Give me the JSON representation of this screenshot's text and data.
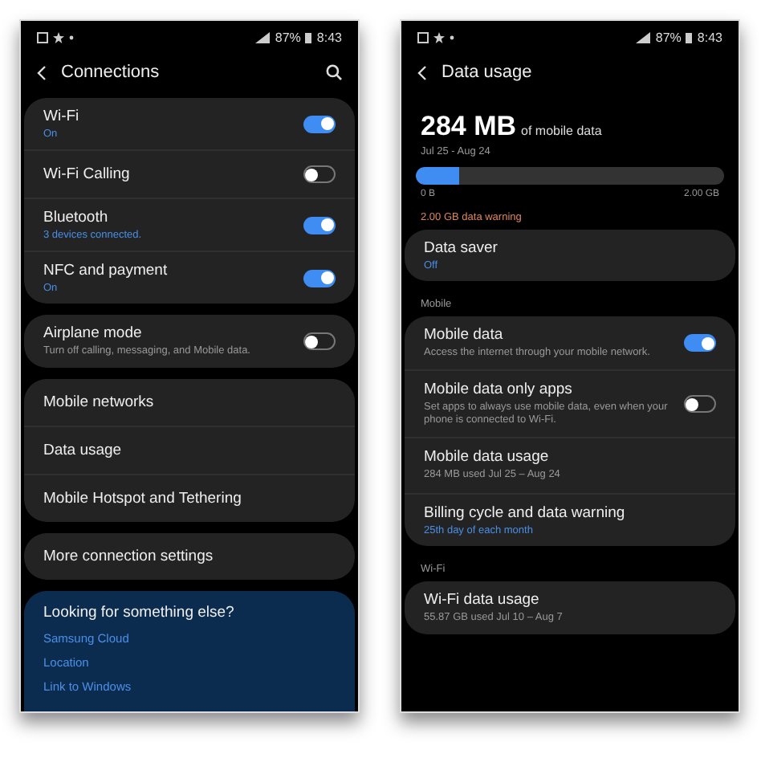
{
  "connections": {
    "status_bar": {
      "battery": "87%",
      "time": "8:43"
    },
    "title": "Connections",
    "groups": [
      {
        "items": [
          {
            "label": "Wi-Fi",
            "status": "On",
            "toggle": true
          },
          {
            "label": "Wi-Fi Calling",
            "toggle": false
          },
          {
            "label": "Bluetooth",
            "status": "3 devices connected.",
            "toggle": true
          },
          {
            "label": "NFC and payment",
            "status": "On",
            "toggle": true
          }
        ]
      },
      {
        "items": [
          {
            "label": "Airplane mode",
            "description": "Turn off calling, messaging, and Mobile data.",
            "toggle": false
          }
        ]
      },
      {
        "items": [
          {
            "label": "Mobile networks"
          },
          {
            "label": "Data usage"
          },
          {
            "label": "Mobile Hotspot and Tethering"
          }
        ]
      },
      {
        "items": [
          {
            "label": "More connection settings"
          }
        ]
      }
    ],
    "suggestions": {
      "title": "Looking for something else?",
      "links": [
        "Samsung Cloud",
        "Location",
        "Link to Windows"
      ]
    }
  },
  "data_usage": {
    "status_bar": {
      "battery": "87%",
      "time": "8:43"
    },
    "title": "Data usage",
    "amount": "284 MB",
    "amount_suffix": "of mobile data",
    "period": "Jul 25 - Aug 24",
    "usage_bar": {
      "level": 0.14,
      "min_label": "0 B",
      "max_label": "2.00 GB"
    },
    "warning": "2.00 GB data warning",
    "sections": [
      {
        "items": [
          {
            "label": "Data saver",
            "status": "Off"
          }
        ]
      },
      {
        "header": "Mobile",
        "items": [
          {
            "label": "Mobile data",
            "description": "Access the internet through your mobile network.",
            "toggle": true
          },
          {
            "label": "Mobile data only apps",
            "description": "Set apps to always use mobile data, even when your phone is connected to Wi-Fi.",
            "toggle": false
          },
          {
            "label": "Mobile data usage",
            "description": "284 MB used Jul 25 – Aug 24"
          },
          {
            "label": "Billing cycle and data warning",
            "status": "25th day of each month"
          }
        ]
      },
      {
        "header": "Wi-Fi",
        "items": [
          {
            "label": "Wi-Fi data usage",
            "description": "55.87 GB used Jul 10 – Aug 7"
          }
        ]
      }
    ]
  }
}
